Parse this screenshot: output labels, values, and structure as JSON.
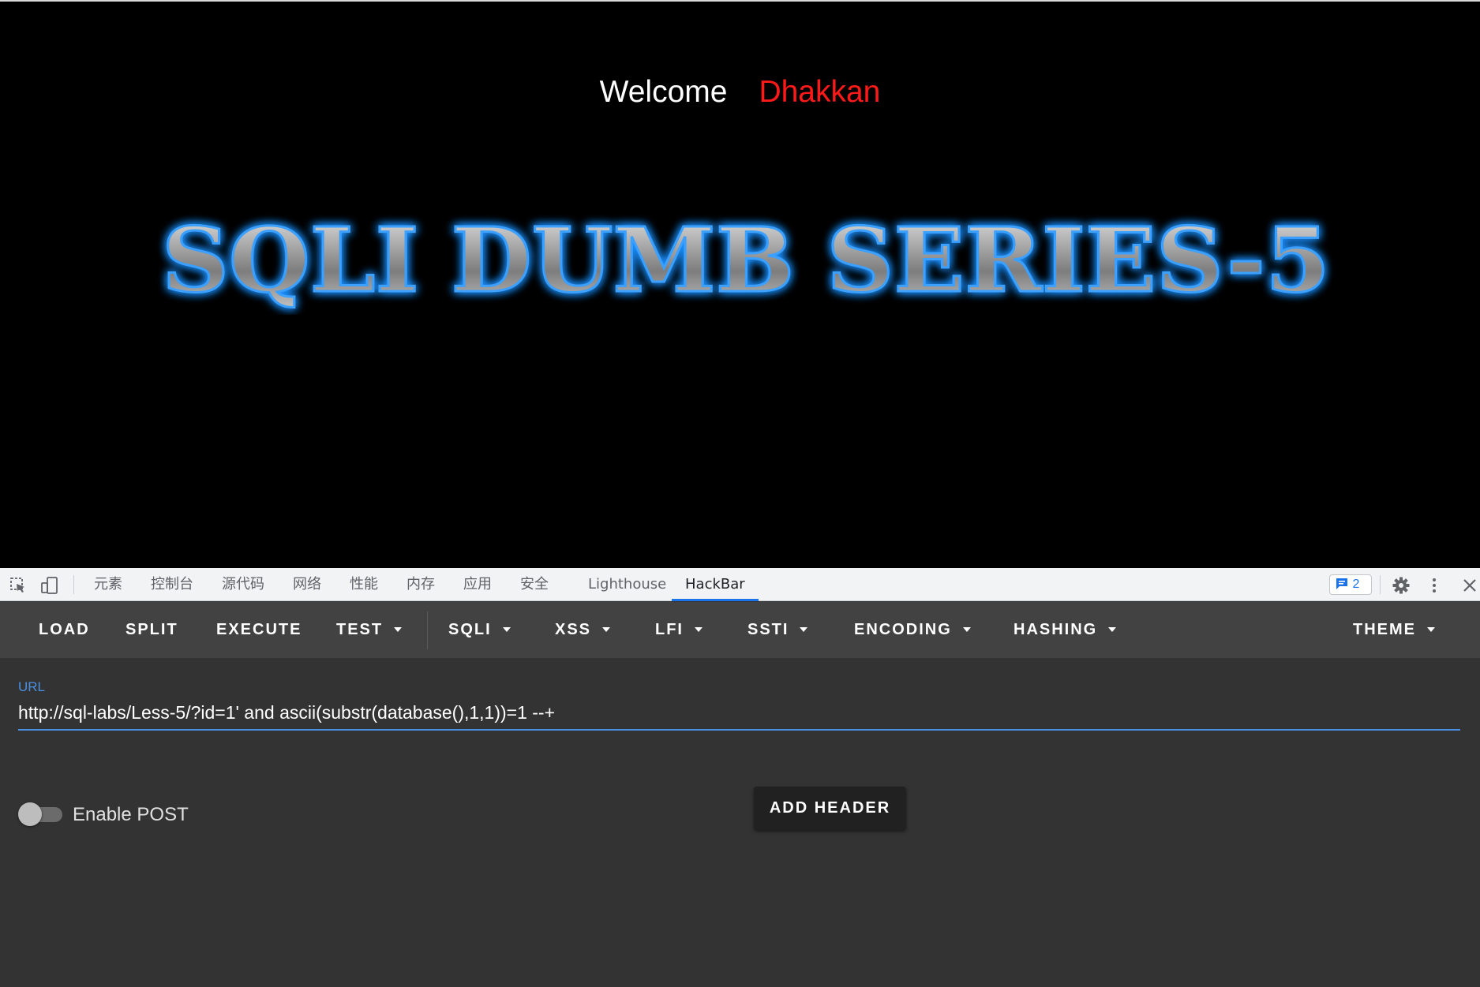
{
  "page": {
    "welcome_text": "Welcome",
    "user_name": "Dhakkan",
    "banner_title": "SQLI DUMB SERIES-5"
  },
  "devtools": {
    "tabs": [
      "元素",
      "控制台",
      "源代码",
      "网络",
      "性能",
      "内存",
      "应用",
      "安全",
      "Lighthouse",
      "HackBar"
    ],
    "active_tab": "HackBar",
    "issues_count": "2",
    "icons": [
      "inspect-element-icon",
      "device-toolbar-icon",
      "issues-icon",
      "gear-icon",
      "more-vert-icon",
      "close-icon"
    ]
  },
  "hackbar": {
    "toolbar": {
      "load": "LOAD",
      "split": "SPLIT",
      "execute": "EXECUTE",
      "test": "TEST",
      "sqli": "SQLI",
      "xss": "XSS",
      "lfi": "LFI",
      "ssti": "SSTI",
      "encoding": "ENCODING",
      "hashing": "HASHING",
      "theme": "THEME"
    },
    "url_label": "URL",
    "url_value": "http://sql-labs/Less-5/?id=1' and ascii(substr(database(),1,1))=1 --+",
    "enable_post_label": "Enable POST",
    "enable_post": false,
    "add_header_label": "ADD HEADER"
  },
  "colors": {
    "background": "#000000",
    "welcome": "#ffffff",
    "user_name": "#ff1a1a",
    "banner_glow": "#1e90ff",
    "hackbar_bg": "#333333",
    "toolbar_bg": "#424242",
    "accent": "#4a90e2"
  }
}
